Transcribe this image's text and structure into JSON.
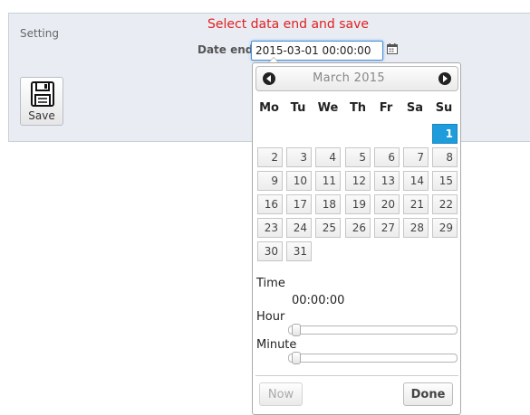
{
  "panel": {
    "setting_label": "Setting",
    "notice": "Select data end and save",
    "notice_color": "#e02020"
  },
  "date_field": {
    "label": "Date end",
    "value": "2015-03-01 00:00:00"
  },
  "save_button": {
    "label": "Save"
  },
  "datepicker": {
    "month_title": "March 2015",
    "weekdays": [
      "Mo",
      "Tu",
      "We",
      "Th",
      "Fr",
      "Sa",
      "Su"
    ],
    "days": [
      "1",
      "2",
      "3",
      "4",
      "5",
      "6",
      "7",
      "8",
      "9",
      "10",
      "11",
      "12",
      "13",
      "14",
      "15",
      "16",
      "17",
      "18",
      "19",
      "20",
      "21",
      "22",
      "23",
      "24",
      "25",
      "26",
      "27",
      "28",
      "29",
      "30",
      "31"
    ],
    "selected_day": "1",
    "selected_color": "#1e9cdc",
    "time_label": "Time",
    "time_value": "00:00:00",
    "hour_label": "Hour",
    "minute_label": "Minute",
    "hour_value": 0,
    "minute_value": 0,
    "now_label": "Now",
    "done_label": "Done"
  }
}
